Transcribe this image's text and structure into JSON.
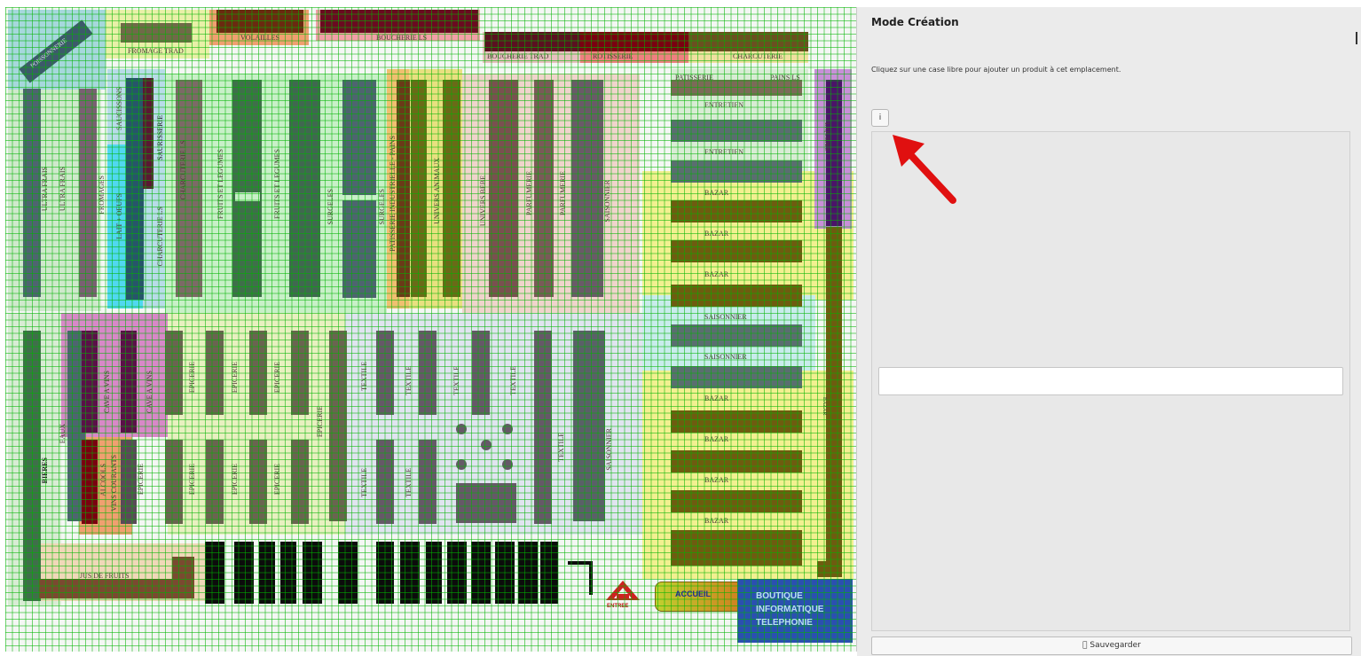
{
  "panel": {
    "title": "Mode Création",
    "instruction": "Cliquez sur une case libre pour ajouter un produit à cet emplacement.",
    "info_button": "i",
    "input_value": "",
    "save_button": "\u0000 Sauvegarder",
    "arrow_color": "#e01010"
  },
  "map": {
    "labels": {
      "poissonnerie": "POISSONNERIE",
      "fromage_trad": "FROMAGE TRAD",
      "volailles": "VOLAILLES",
      "boucherie_ls": "BOUCHERIE LS",
      "boucherie_trad": "BOUCHERIE TRAD",
      "rotisserie": "ROTISSERIE",
      "charcuterie": "CHARCUTERIE",
      "patisserie": "PATISSERIE",
      "pains": "PAINS LS",
      "entretien1": "ENTRETIEN",
      "entretien2": "ENTRETIEN",
      "bazar1": "BAZAR",
      "bazar2": "BAZAR",
      "bazar3": "BAZAR",
      "saisonnier1": "SAISONNIER",
      "saisonnier2": "SAISONNIER",
      "bazar4": "BAZAR",
      "bazar5": "BAZAR",
      "bazar6": "BAZAR",
      "bazar7": "BAZAR",
      "bazar_v": "BAZAR",
      "liquides": "LIQUIDES",
      "ultra_frais1": "ULTRA FRAIS",
      "ultra_frais2": "ULTRA FRAIS",
      "fromages": "FROMAGES",
      "saucissons": "SAUCISSONS",
      "lait_oeufs": "LAIT + OEUFS",
      "saurisserie": "SAURISSERIE",
      "charcuterie_ls": "CHARCUTERIE LS",
      "charcuterie_ls2": "CHARCUTERIE LS",
      "fruits_legumes1": "FRUITS ET LEGUMES",
      "fruits_legumes2": "FRUITS ET LEGUMES",
      "surgeles1": "SURGELES",
      "surgeles2": "SURGELES",
      "patisserie_industrielle": "PATISSERIE INDUSTRIELLE - PAINS",
      "univers_animaux": "UNIVERS ANIMAUX",
      "univers_bebe": "UNIVERS BEBE",
      "parfumerie1": "PARFUMERIE",
      "parfumerie2": "PARFUMERIE",
      "saisonnier_v": "SAISONNIER",
      "bieres": "BIERES",
      "eaux": "EAUX",
      "cave_vins1": "CAVE A VINS",
      "cave_vins2": "CAVE A VINS",
      "alcools": "ALCOOLS",
      "vins_courants": "VINS COURANTS",
      "epicerie1": "EPICERIE",
      "epicerie2": "EPICERIE",
      "epicerie3": "EPICERIE",
      "epicerie4": "EPICERIE",
      "epicerie5": "EPICERIE",
      "epicerie6": "EPICERIE",
      "epicerie7": "EPICERIE",
      "epicerie8": "EPICERIE",
      "epicerie9": "EPICERIE",
      "textile1": "TEXTILE",
      "textile2": "TEXTILE",
      "textile3": "TEXTILE",
      "textile4": "TEXTILE",
      "textile5": "TEXTILE",
      "textile6": "TEXTILE",
      "textile7": "TEXTILE",
      "saisonnier_v2": "SAISONNIER",
      "jus_de_fruits": "JUS DE FRUITS",
      "entree": "ENTREE",
      "accueil": "ACCUEIL",
      "boutique1": "BOUTIQUE",
      "boutique2": "INFORMATIQUE",
      "boutique3": "TELEPHONIE"
    }
  }
}
